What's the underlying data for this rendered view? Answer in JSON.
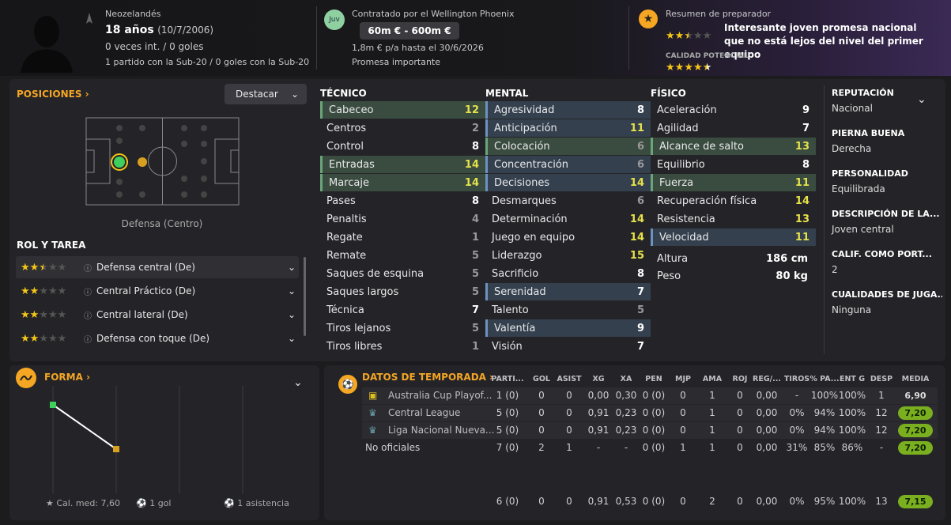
{
  "player": {
    "nationality": "Neozelandés",
    "age": "18 años",
    "birth": "(10/7/2006)",
    "caps": "0 veces int. / 0 goles",
    "u20": "1 partido con la Sub-20 / 0 goles con la Sub-20"
  },
  "contract": {
    "badge": "Juv",
    "club": "Contratado por el Wellington Phoenix",
    "value": "60m € - 600m €",
    "wage": "1,8m € p/a hasta el 30/6/2026",
    "status": "Promesa importante"
  },
  "coach": {
    "title": "Resumen de preparador",
    "summary": "Interesante joven promesa nacional que no está lejos del nivel del primer equipo",
    "potential_label": "CALIDAD POTENCIAL",
    "current_stars": 2.5,
    "potential_stars": 4.5
  },
  "positions": {
    "title": "POSICIONES",
    "highlight_button": "Destacar",
    "position_label": "Defensa (Centro)"
  },
  "roles": {
    "title": "ROL Y TAREA",
    "items": [
      {
        "label": "Defensa central (De)",
        "stars": 2.5
      },
      {
        "label": "Central Práctico (De)",
        "stars": 2
      },
      {
        "label": "Central lateral (De)",
        "stars": 2
      },
      {
        "label": "Defensa con toque (De)",
        "stars": 2
      }
    ]
  },
  "tecnico": {
    "title": "TÉCNICO",
    "items": [
      {
        "name": "Cabeceo",
        "value": "12",
        "hl": "green"
      },
      {
        "name": "Centros",
        "value": "2",
        "hl": ""
      },
      {
        "name": "Control",
        "value": "8",
        "hl": ""
      },
      {
        "name": "Entradas",
        "value": "14",
        "hl": "green"
      },
      {
        "name": "Marcaje",
        "value": "14",
        "hl": "green"
      },
      {
        "name": "Pases",
        "value": "8",
        "hl": ""
      },
      {
        "name": "Penaltis",
        "value": "4",
        "hl": ""
      },
      {
        "name": "Regate",
        "value": "1",
        "hl": ""
      },
      {
        "name": "Remate",
        "value": "5",
        "hl": ""
      },
      {
        "name": "Saques de esquina",
        "value": "5",
        "hl": ""
      },
      {
        "name": "Saques largos",
        "value": "5",
        "hl": ""
      },
      {
        "name": "Técnica",
        "value": "7",
        "hl": ""
      },
      {
        "name": "Tiros lejanos",
        "value": "5",
        "hl": ""
      },
      {
        "name": "Tiros libres",
        "value": "1",
        "hl": ""
      }
    ]
  },
  "mental": {
    "title": "MENTAL",
    "items": [
      {
        "name": "Agresividad",
        "value": "8",
        "hl": "blue"
      },
      {
        "name": "Anticipación",
        "value": "11",
        "hl": "blue"
      },
      {
        "name": "Colocación",
        "value": "6",
        "hl": "green"
      },
      {
        "name": "Concentración",
        "value": "6",
        "hl": "blue"
      },
      {
        "name": "Decisiones",
        "value": "14",
        "hl": "blue"
      },
      {
        "name": "Desmarques",
        "value": "6",
        "hl": ""
      },
      {
        "name": "Determinación",
        "value": "14",
        "hl": ""
      },
      {
        "name": "Juego en equipo",
        "value": "14",
        "hl": ""
      },
      {
        "name": "Liderazgo",
        "value": "15",
        "hl": ""
      },
      {
        "name": "Sacrificio",
        "value": "8",
        "hl": ""
      },
      {
        "name": "Serenidad",
        "value": "7",
        "hl": "blue"
      },
      {
        "name": "Talento",
        "value": "5",
        "hl": ""
      },
      {
        "name": "Valentía",
        "value": "9",
        "hl": "blue"
      },
      {
        "name": "Visión",
        "value": "7",
        "hl": ""
      }
    ]
  },
  "fisico": {
    "title": "FÍSICO",
    "items": [
      {
        "name": "Aceleración",
        "value": "9",
        "hl": ""
      },
      {
        "name": "Agilidad",
        "value": "7",
        "hl": ""
      },
      {
        "name": "Alcance de salto",
        "value": "13",
        "hl": "green"
      },
      {
        "name": "Equilibrio",
        "value": "8",
        "hl": ""
      },
      {
        "name": "Fuerza",
        "value": "11",
        "hl": "green"
      },
      {
        "name": "Recuperación física",
        "value": "14",
        "hl": ""
      },
      {
        "name": "Resistencia",
        "value": "13",
        "hl": ""
      },
      {
        "name": "Velocidad",
        "value": "11",
        "hl": "blue"
      }
    ],
    "height_label": "Altura",
    "height": "186 cm",
    "weight_label": "Peso",
    "weight": "80 kg"
  },
  "info": [
    {
      "label": "REPUTACIÓN",
      "value": "Nacional"
    },
    {
      "label": "PIERNA BUENA",
      "value": "Derecha"
    },
    {
      "label": "PERSONALIDAD",
      "value": "Equilibrada"
    },
    {
      "label": "DESCRIPCIÓN DE LA...",
      "value": "Joven central"
    },
    {
      "label": "CALIF. COMO PORT...",
      "value": "2"
    },
    {
      "label": "CUALIDADES DE JUGA...",
      "value": "Ninguna"
    }
  ],
  "form": {
    "title": "FORMA",
    "avg": "Cal. med: 7,60",
    "goals": "1 gol",
    "assists": "1 asistencia",
    "points": [
      7.9,
      7.2
    ]
  },
  "season": {
    "title": "DATOS DE TEMPORADA",
    "headers": [
      "PARTI...",
      "GOL",
      "ASIST",
      "XG",
      "XA",
      "PEN",
      "MJP",
      "AMA",
      "ROJ",
      "REG/...",
      "TIROS",
      "% PA...",
      "ENT G",
      "DESP",
      "MEDIA"
    ],
    "rows": [
      {
        "comp": "Australia Cup Playof...",
        "cells": [
          "1 (0)",
          "0",
          "0",
          "0,00",
          "0,30",
          "0 (0)",
          "0",
          "1",
          "0",
          "0,00",
          "-",
          "100%",
          "100%",
          "1"
        ],
        "media": "6,90",
        "badge": "plain",
        "dim": true
      },
      {
        "comp": "Central League",
        "cells": [
          "5 (0)",
          "0",
          "0",
          "0,91",
          "0,23",
          "0 (0)",
          "0",
          "1",
          "0",
          "0,00",
          "0%",
          "94%",
          "100%",
          "12"
        ],
        "media": "7,20",
        "badge": "green",
        "dim": true
      },
      {
        "comp": "Liga Nacional Nueva...",
        "cells": [
          "5 (0)",
          "0",
          "0",
          "0,91",
          "0,23",
          "0 (0)",
          "0",
          "1",
          "0",
          "0,00",
          "0%",
          "94%",
          "100%",
          "12"
        ],
        "media": "7,20",
        "badge": "green",
        "dim": true
      },
      {
        "comp": "No oficiales",
        "cells": [
          "7 (0)",
          "2",
          "1",
          "-",
          "-",
          "0 (0)",
          "1",
          "1",
          "0",
          "0,00",
          "31%",
          "85%",
          "86%",
          "-"
        ],
        "media": "7,20",
        "badge": "green",
        "dim": false
      }
    ],
    "total": {
      "cells": [
        "6 (0)",
        "0",
        "0",
        "0,91",
        "0,53",
        "0 (0)",
        "0",
        "2",
        "0",
        "0,00",
        "0%",
        "95%",
        "100%",
        "13"
      ],
      "media": "7,15"
    }
  }
}
